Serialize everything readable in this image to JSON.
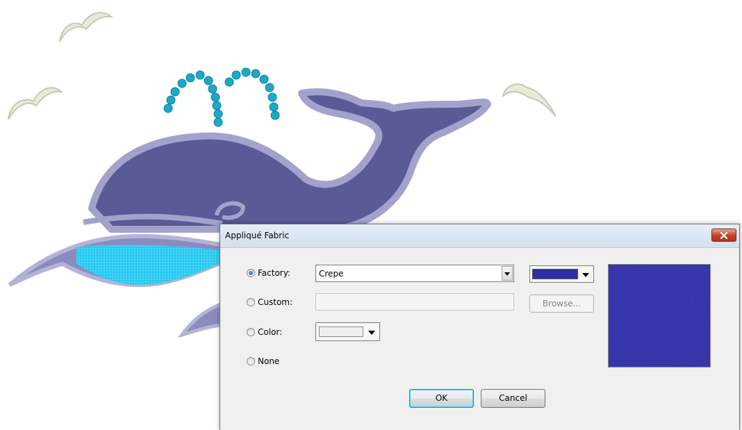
{
  "dialog": {
    "title": "Appliqué Fabric",
    "options": {
      "factory_label": "Factory:",
      "custom_label": "Custom:",
      "color_label": "Color:",
      "none_label": "None",
      "selected": "factory"
    },
    "factory_value": "Crepe",
    "custom_value": "",
    "browse_label": "Browse...",
    "ok_label": "OK",
    "cancel_label": "Cancel"
  },
  "colors": {
    "factory_swatch": "#2e2ea6",
    "color_swatch": "#f0f0f0",
    "preview_fabric": "#2a2aa3",
    "whale_body": "#5a5a96",
    "whale_outline": "#9b9bc6",
    "water": "#1fc6ee",
    "spout": "#1ba7c8",
    "gulls": "#e6ecd8"
  }
}
